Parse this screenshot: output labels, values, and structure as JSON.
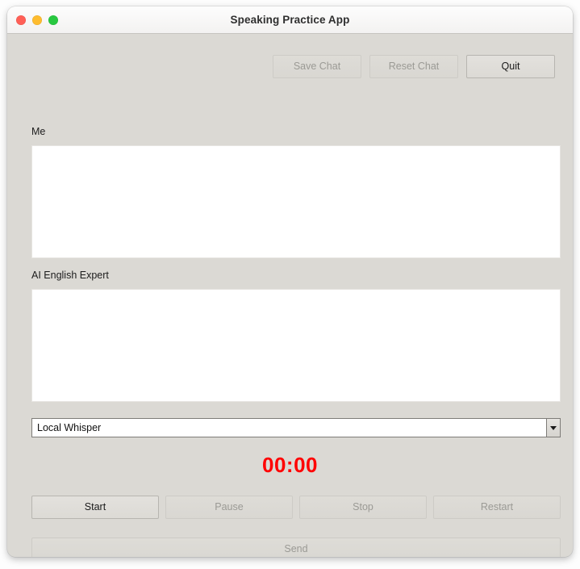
{
  "window": {
    "title": "Speaking Practice App",
    "traffic_lights": [
      {
        "name": "close",
        "color": "#ff5f56"
      },
      {
        "name": "minimize",
        "color": "#febc2e"
      },
      {
        "name": "maximize",
        "color": "#28c840"
      }
    ]
  },
  "toolbar": {
    "save_chat_label": "Save Chat",
    "reset_chat_label": "Reset Chat",
    "quit_label": "Quit"
  },
  "fields": {
    "me_label": "Me",
    "me_value": "",
    "ai_label": "AI English Expert",
    "ai_value": ""
  },
  "engine_select": {
    "selected": "Local Whisper",
    "arrow_icon": "chevron-down-icon"
  },
  "timer": {
    "value": "00:00",
    "color": "#ff0000"
  },
  "transport": {
    "start_label": "Start",
    "pause_label": "Pause",
    "stop_label": "Stop",
    "restart_label": "Restart"
  },
  "send": {
    "label": "Send"
  }
}
